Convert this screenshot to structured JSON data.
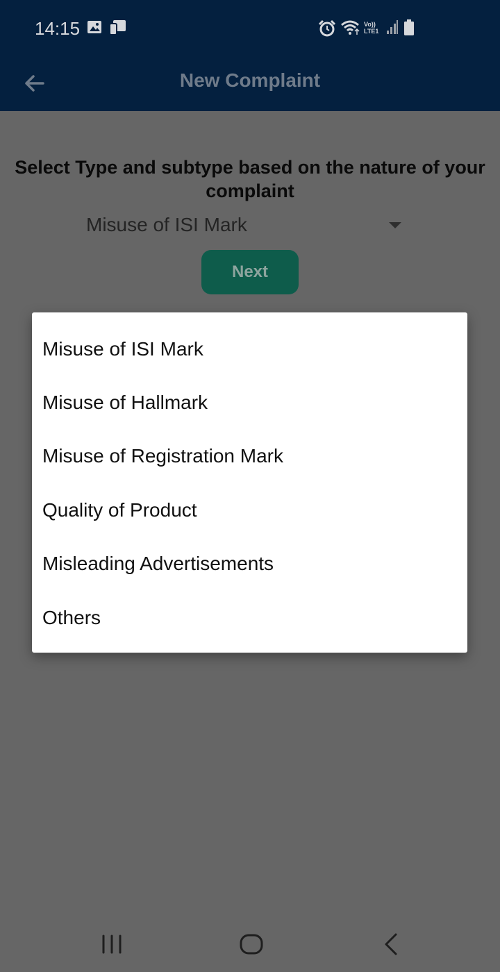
{
  "status_bar": {
    "time": "14:15",
    "icons": [
      "image-icon",
      "screen-cast-icon",
      "alarm-icon",
      "wifi-icon",
      "volte-lte-icon",
      "signal-icon",
      "battery-icon"
    ],
    "volte_label": "Vo))",
    "lte_label": "LTE1"
  },
  "app_bar": {
    "title": "New Complaint",
    "back_icon": "arrow-left-icon"
  },
  "form": {
    "prompt": "Select Type and subtype based on the nature of your complaint",
    "selected_type": "Misuse of ISI Mark",
    "next_label": "Next"
  },
  "dropdown": {
    "options": [
      "Misuse of ISI Mark",
      "Misuse of Hallmark",
      "Misuse of Registration Mark",
      "Quality of Product",
      "Misleading Advertisements",
      "Others"
    ]
  },
  "nav_bar": {
    "icons": [
      "recent-apps-icon",
      "home-icon",
      "back-icon"
    ]
  },
  "colors": {
    "app_bar": "#04203f",
    "dim_overlay": "#666666",
    "next_button": "#0e5c4b",
    "dropdown_bg": "#ffffff"
  }
}
